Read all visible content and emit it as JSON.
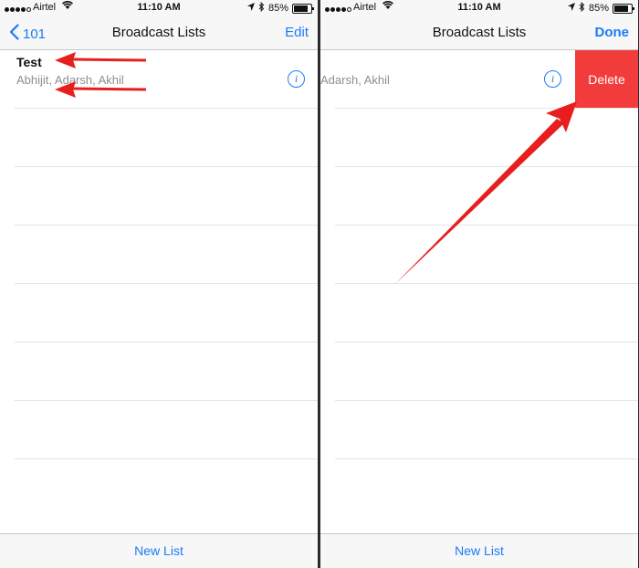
{
  "status_bar": {
    "carrier": "Airtel",
    "time": "11:10 AM",
    "battery": "85%",
    "battery_level": 0.85
  },
  "left_screen": {
    "nav": {
      "back_label": "101",
      "title": "Broadcast Lists",
      "right_label": "Edit"
    },
    "list": [
      {
        "name": "Test",
        "members": "Abhijit, Adarsh, Akhil"
      }
    ],
    "bottom_label": "New List"
  },
  "right_screen": {
    "nav": {
      "title": "Broadcast Lists",
      "right_label": "Done"
    },
    "list": [
      {
        "members": "Adarsh, Akhil",
        "delete_label": "Delete"
      }
    ],
    "bottom_label": "New List"
  },
  "colors": {
    "accent": "#1a7cf5",
    "delete": "#f23c3c",
    "annotation_arrow": "#e81e1e"
  },
  "icons": [
    "signal-icon",
    "wifi-icon",
    "location-icon",
    "bluetooth-icon",
    "battery-icon",
    "chevron-left-icon",
    "info-icon"
  ]
}
